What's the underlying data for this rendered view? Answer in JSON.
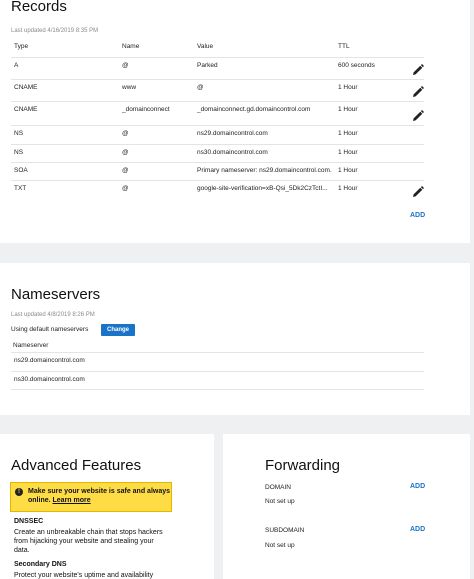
{
  "records": {
    "title": "Records",
    "last_updated": "Last updated 4/16/2019 8:35 PM",
    "columns": [
      "Type",
      "Name",
      "Value",
      "TTL"
    ],
    "rows": [
      {
        "type": "A",
        "name": "@",
        "value": "Parked",
        "ttl": "600 seconds",
        "editable": true
      },
      {
        "type": "CNAME",
        "name": "www",
        "value": "@",
        "ttl": "1 Hour",
        "editable": true
      },
      {
        "type": "CNAME",
        "name": "_domainconnect",
        "value": "_domainconnect.gd.domaincontrol.com",
        "ttl": "1 Hour",
        "editable": true
      },
      {
        "type": "NS",
        "name": "@",
        "value": "ns29.domaincontrol.com",
        "ttl": "1 Hour",
        "editable": false
      },
      {
        "type": "NS",
        "name": "@",
        "value": "ns30.domaincontrol.com",
        "ttl": "1 Hour",
        "editable": false
      },
      {
        "type": "SOA",
        "name": "@",
        "value": "Primary nameserver: ns29.domaincontrol.com.",
        "ttl": "1 Hour",
        "editable": false
      },
      {
        "type": "TXT",
        "name": "@",
        "value": "google-site-verification=xB-Qsi_5Dk2CzTctI...",
        "ttl": "1 Hour",
        "editable": true
      }
    ],
    "add_label": "ADD",
    "edit_icon": "pencil-icon"
  },
  "nameservers": {
    "title": "Nameservers",
    "last_updated": "Last updated 4/8/2019 8:26 PM",
    "using_text": "Using default nameservers",
    "change_label": "Change",
    "column": "Nameserver",
    "rows": [
      "ns29.domaincontrol.com",
      "ns30.domaincontrol.com"
    ]
  },
  "advanced": {
    "title": "Advanced Features",
    "warning_text": "Make sure your website is safe and always online.",
    "warning_link": "Learn more",
    "features": [
      {
        "title": "DNSSEC",
        "desc": "Create an unbreakable chain that stops hackers from hijacking your website and stealing your data."
      },
      {
        "title": "Secondary DNS",
        "desc": "Protect your website's uptime and availability"
      }
    ]
  },
  "forwarding": {
    "title": "Forwarding",
    "items": [
      {
        "label": "DOMAIN",
        "value": "Not set up",
        "add_label": "ADD"
      },
      {
        "label": "SUBDOMAIN",
        "value": "Not set up",
        "add_label": "ADD"
      }
    ]
  },
  "colors": {
    "accent": "#1a73c6",
    "warning": "#fedc46",
    "background": "#eef0f2"
  }
}
